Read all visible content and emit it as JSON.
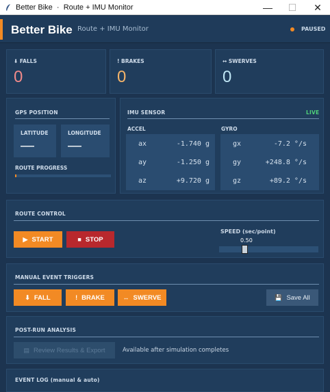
{
  "window": {
    "title": "Better Bike  ·  Route + IMU Monitor",
    "minimize": "—",
    "maximize": "☐",
    "close": "✕"
  },
  "header": {
    "brand": "Better Bike",
    "subtitle": "Route + IMU Monitor",
    "status": "PAUSED"
  },
  "stats": [
    {
      "label": "⬇ FALLS",
      "value": "0",
      "color": "#f08a8a"
    },
    {
      "label": "! BRAKES",
      "value": "0",
      "color": "#f4b46a"
    },
    {
      "label": "↔ SWERVES",
      "value": "0",
      "color": "#bfe6f5"
    }
  ],
  "gps": {
    "title": "GPS POSITION",
    "latitude_label": "LATITUDE",
    "latitude_value": "—",
    "longitude_label": "LONGITUDE",
    "longitude_value": "—",
    "progress_label": "ROUTE PROGRESS",
    "progress_fraction": 0.01
  },
  "imu": {
    "title": "IMU SENSOR",
    "status": "LIVE",
    "accel_label": "ACCEL",
    "gyro_label": "GYRO",
    "accel": [
      {
        "axis": "ax",
        "value": "-1.740 g"
      },
      {
        "axis": "ay",
        "value": "-1.250 g"
      },
      {
        "axis": "az",
        "value": "+9.720 g"
      }
    ],
    "gyro": [
      {
        "axis": "gx",
        "value": "-7.2 °/s"
      },
      {
        "axis": "gy",
        "value": "+248.8 °/s"
      },
      {
        "axis": "gz",
        "value": "+89.2 °/s"
      }
    ]
  },
  "route_control": {
    "title": "ROUTE CONTROL",
    "start_label": "START",
    "stop_label": "STOP",
    "speed_label": "SPEED (sec/point)",
    "speed_value": "0.50",
    "speed_fraction": 0.24
  },
  "triggers": {
    "title": "MANUAL EVENT TRIGGERS",
    "fall_label": "FALL",
    "brake_label": "BRAKE",
    "swerve_label": "SWERVE",
    "save_label": "Save All"
  },
  "post_run": {
    "title": "POST-RUN ANALYSIS",
    "review_label": "Review Results & Export",
    "note": "Available after simulation completes"
  },
  "event_log": {
    "title": "EVENT LOG (manual & auto)"
  },
  "colors": {
    "accent": "#f28a24",
    "live": "#4fd07a",
    "stop": "#b8282d"
  }
}
